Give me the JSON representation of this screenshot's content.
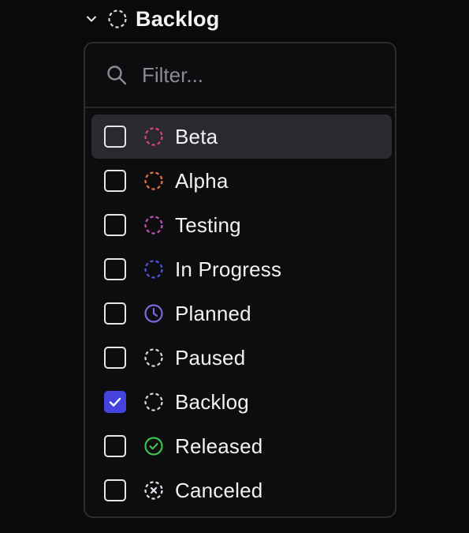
{
  "trigger": {
    "label": "Backlog",
    "icon": "chevron-down-icon",
    "status_icon": "dashed-circle-icon",
    "status_color": "#d9d9de"
  },
  "search": {
    "placeholder": "Filter...",
    "value": ""
  },
  "statuses": [
    {
      "label": "Beta",
      "icon": "dashed-circle-icon",
      "color": "#e0457b",
      "checked": false,
      "highlighted": true
    },
    {
      "label": "Alpha",
      "icon": "dashed-circle-icon",
      "color": "#e8773a",
      "checked": false,
      "highlighted": false
    },
    {
      "label": "Testing",
      "icon": "dashed-circle-icon",
      "color": "#c94fc0",
      "checked": false,
      "highlighted": false
    },
    {
      "label": "In Progress",
      "icon": "dashed-circle-icon",
      "color": "#4c58e0",
      "checked": false,
      "highlighted": false
    },
    {
      "label": "Planned",
      "icon": "clock-icon",
      "color": "#7b68d9",
      "checked": false,
      "highlighted": false
    },
    {
      "label": "Paused",
      "icon": "dashed-circle-icon",
      "color": "#d9d9de",
      "checked": false,
      "highlighted": false
    },
    {
      "label": "Backlog",
      "icon": "dashed-circle-icon",
      "color": "#d9d9de",
      "checked": true,
      "highlighted": false
    },
    {
      "label": "Released",
      "icon": "check-circle-icon",
      "color": "#3ec24a",
      "checked": false,
      "highlighted": false
    },
    {
      "label": "Canceled",
      "icon": "x-circle-icon",
      "color": "#e6e6ea",
      "checked": false,
      "highlighted": false
    }
  ],
  "colors": {
    "background": "#0a0a0c",
    "panel": "#0d0d10",
    "highlight": "#2a2a2e",
    "accent": "#4543e0"
  }
}
